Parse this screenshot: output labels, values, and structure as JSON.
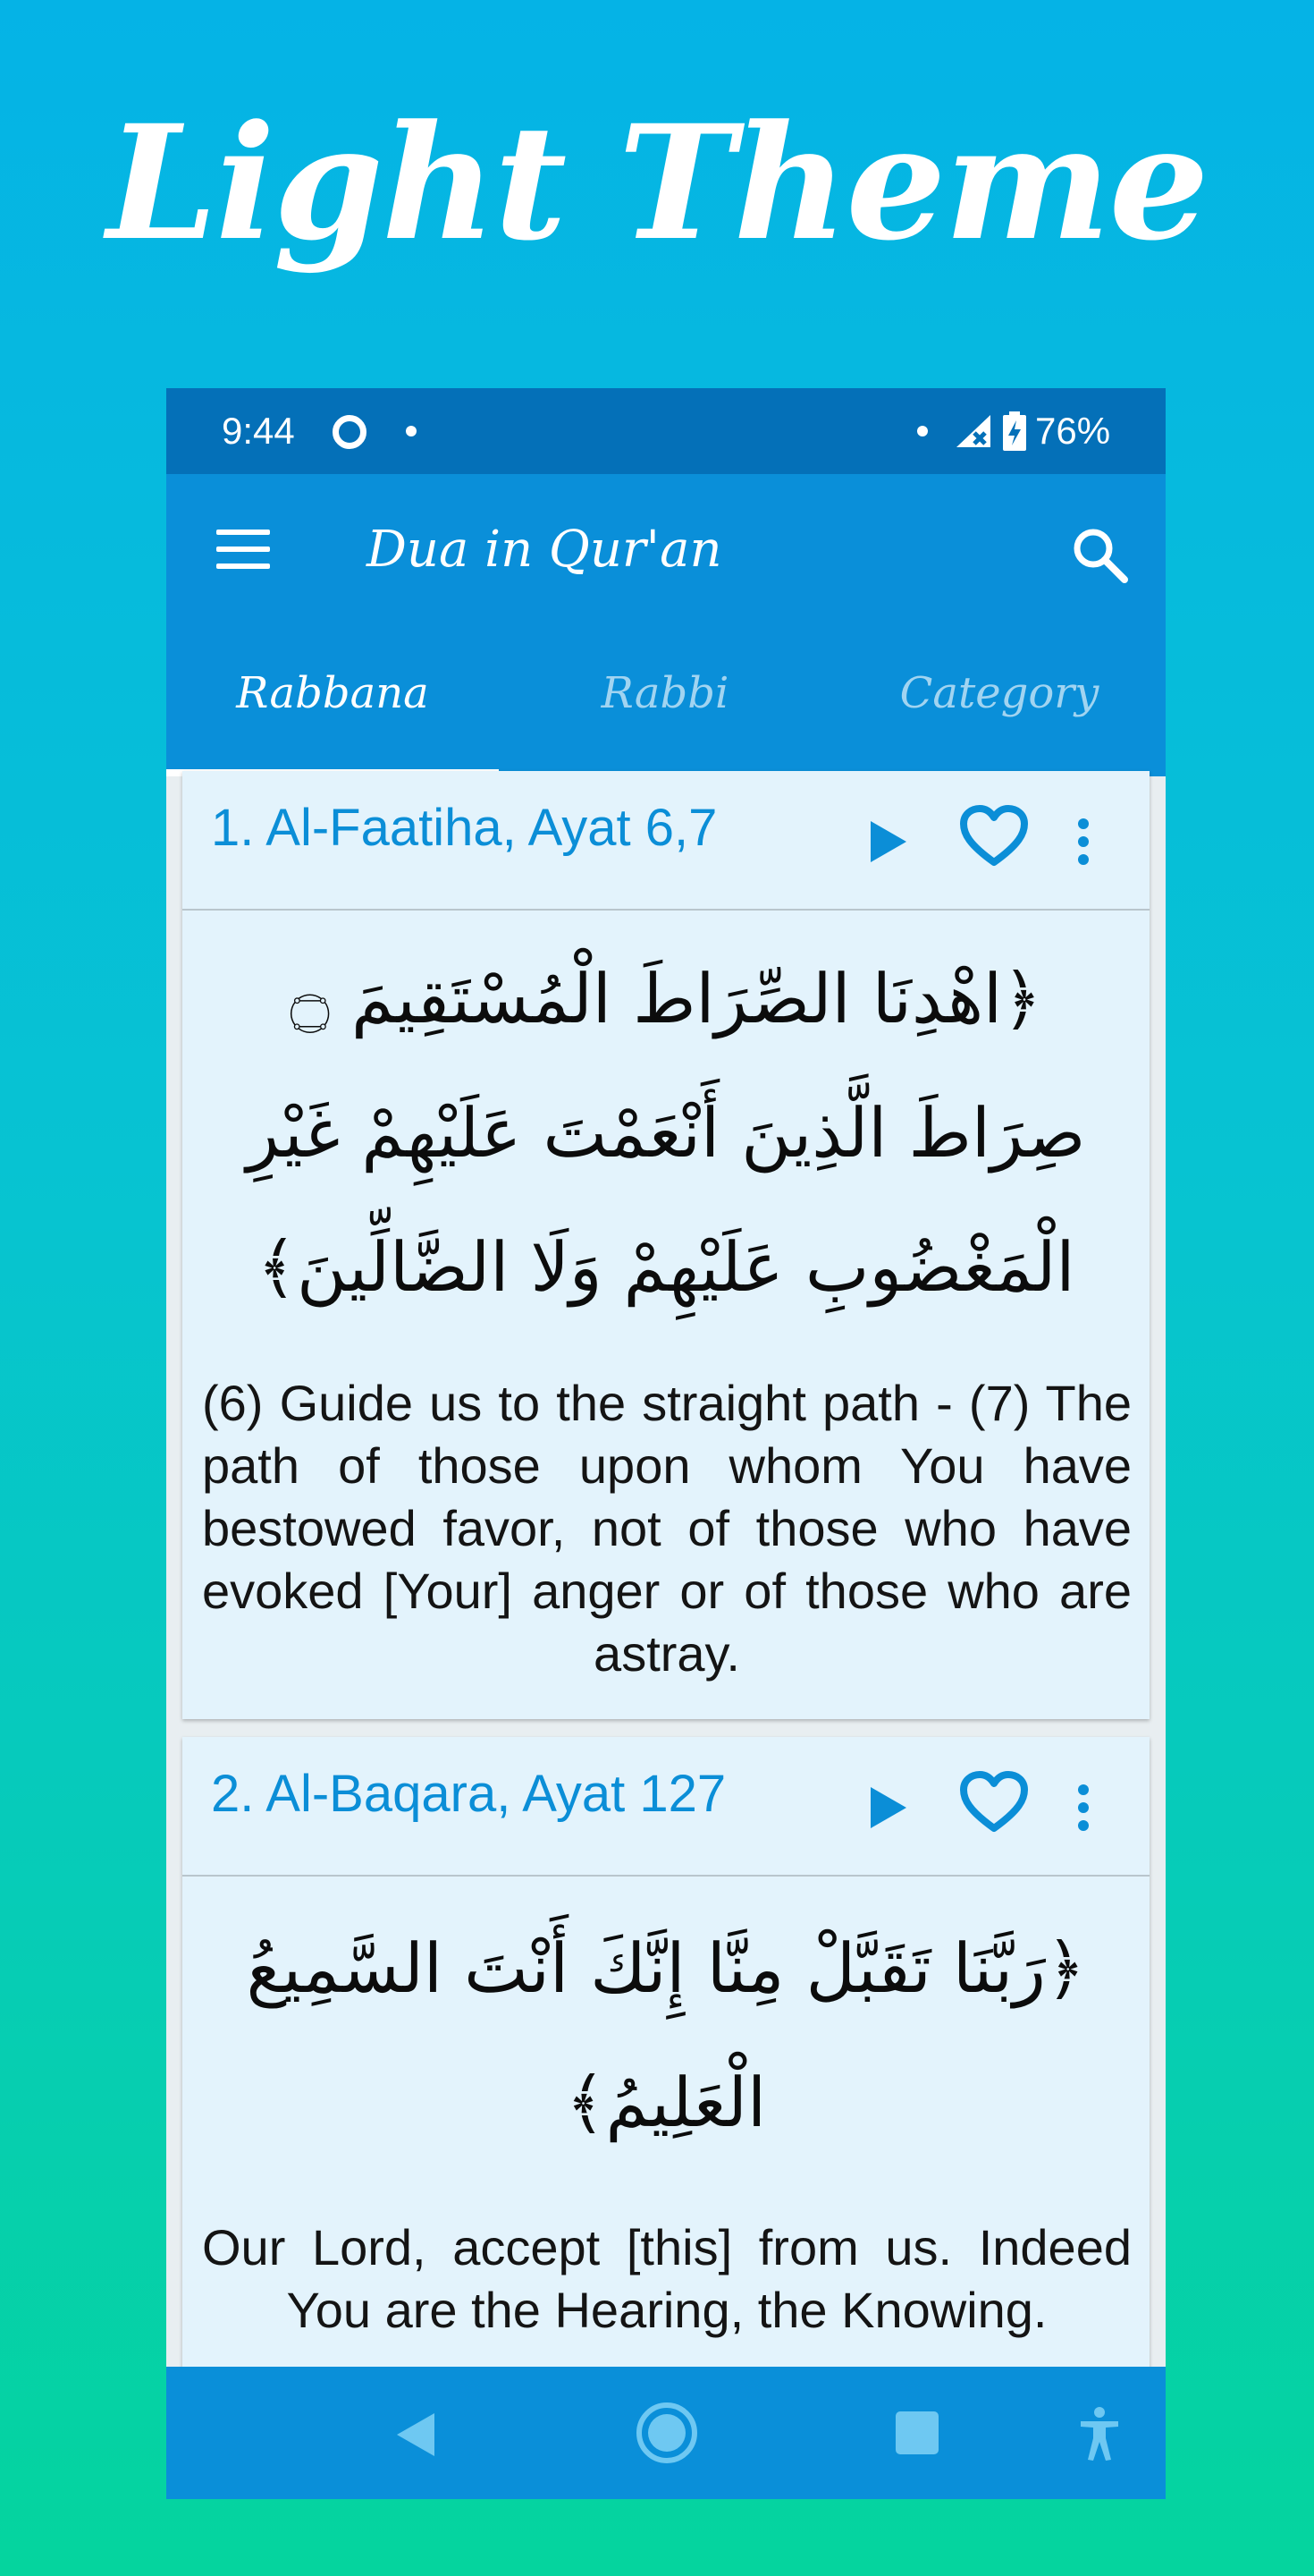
{
  "promo": {
    "title": "Light Theme"
  },
  "status_bar": {
    "time": "9:44",
    "battery": "76%",
    "icons": [
      "record-icon",
      "dot-icon",
      "signal-icon",
      "battery-icon"
    ]
  },
  "app_bar": {
    "title": "Dua in Qur'an",
    "icons": [
      "menu-icon",
      "search-icon"
    ]
  },
  "tabs": [
    {
      "label": "Rabbana",
      "selected": true
    },
    {
      "label": "Rabbi",
      "selected": false
    },
    {
      "label": "Category",
      "selected": false
    }
  ],
  "cards": [
    {
      "title": "1. Al-Faatiha, Ayat 6,7",
      "arabic": "﴿اهْدِنَا الصِّرَاطَ الْمُسْتَقِيمَ ۝ صِرَاطَ الَّذِينَ أَنْعَمْتَ عَلَيْهِمْ غَيْرِ الْمَغْضُوبِ عَلَيْهِمْ وَلَا الضَّالِّينَ﴾",
      "translation": "(6) Guide us to the straight path - (7) The path of those upon whom You have bestowed favor, not of those who have evoked [Your] anger or of those who are astray."
    },
    {
      "title": "2. Al-Baqara, Ayat 127",
      "arabic": "﴿رَبَّنَا تَقَبَّلْ مِنَّا إِنَّكَ أَنْتَ السَّمِيعُ الْعَلِيمُ﴾",
      "translation": "Our Lord, accept [this] from us. Indeed You are the Hearing, the Knowing."
    }
  ],
  "card_icons": [
    "play-icon",
    "heart-icon",
    "more-vertical-icon"
  ],
  "nav_bar": {
    "icons": [
      "back-icon",
      "home-icon",
      "recents-icon",
      "accessibility-icon"
    ]
  },
  "colors": {
    "status_bar": "#0470b8",
    "app_bar": "#0a8fd9",
    "card_background": "#e3f3fc",
    "accent": "#0b8ed7"
  }
}
